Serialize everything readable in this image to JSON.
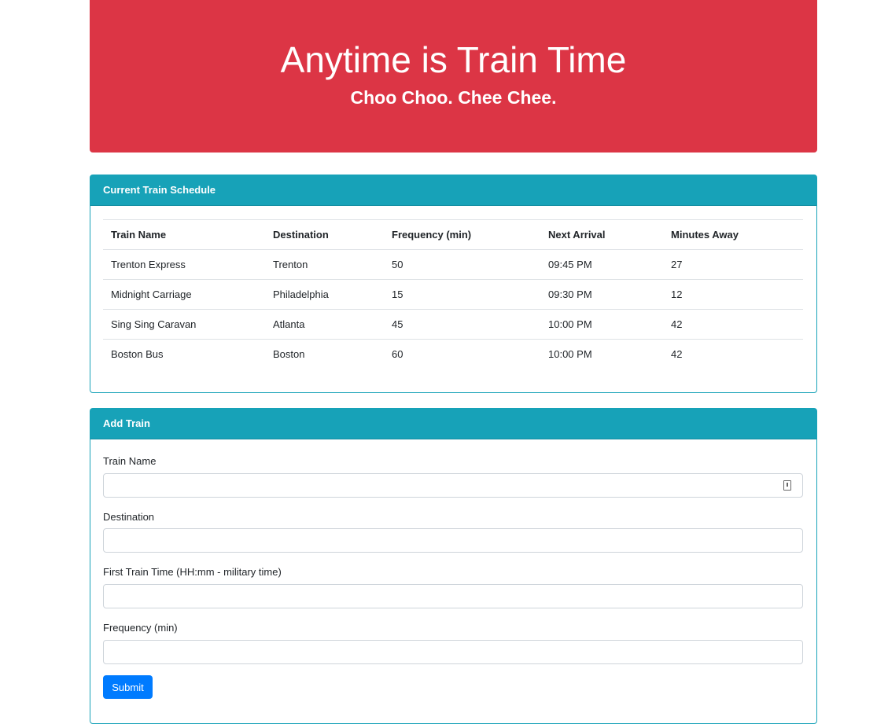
{
  "jumbotron": {
    "title": "Anytime is Train Time",
    "subtitle": "Choo Choo. Chee Chee."
  },
  "schedule": {
    "header": "Current Train Schedule",
    "columns": [
      "Train Name",
      "Destination",
      "Frequency (min)",
      "Next Arrival",
      "Minutes Away"
    ],
    "rows": [
      [
        "Trenton Express",
        "Trenton",
        "50",
        "09:45 PM",
        "27"
      ],
      [
        "Midnight Carriage",
        "Philadelphia",
        "15",
        "09:30 PM",
        "12"
      ],
      [
        "Sing Sing Caravan",
        "Atlanta",
        "45",
        "10:00 PM",
        "42"
      ],
      [
        "Boston Bus",
        "Boston",
        "60",
        "10:00 PM",
        "42"
      ]
    ]
  },
  "add_train": {
    "header": "Add Train",
    "fields": [
      {
        "label": "Train Name",
        "value": "",
        "placeholder": ""
      },
      {
        "label": "Destination",
        "value": "",
        "placeholder": ""
      },
      {
        "label": "First Train Time (HH:mm - military time)",
        "value": "",
        "placeholder": ""
      },
      {
        "label": "Frequency (min)",
        "value": "",
        "placeholder": ""
      }
    ],
    "submit_label": "Submit"
  },
  "colors": {
    "jumbotron": "#dc3545",
    "card_header": "#17a2b8",
    "primary_button": "#007bff"
  },
  "icons": {
    "train_name_input_icon": "password-manager-icon"
  }
}
